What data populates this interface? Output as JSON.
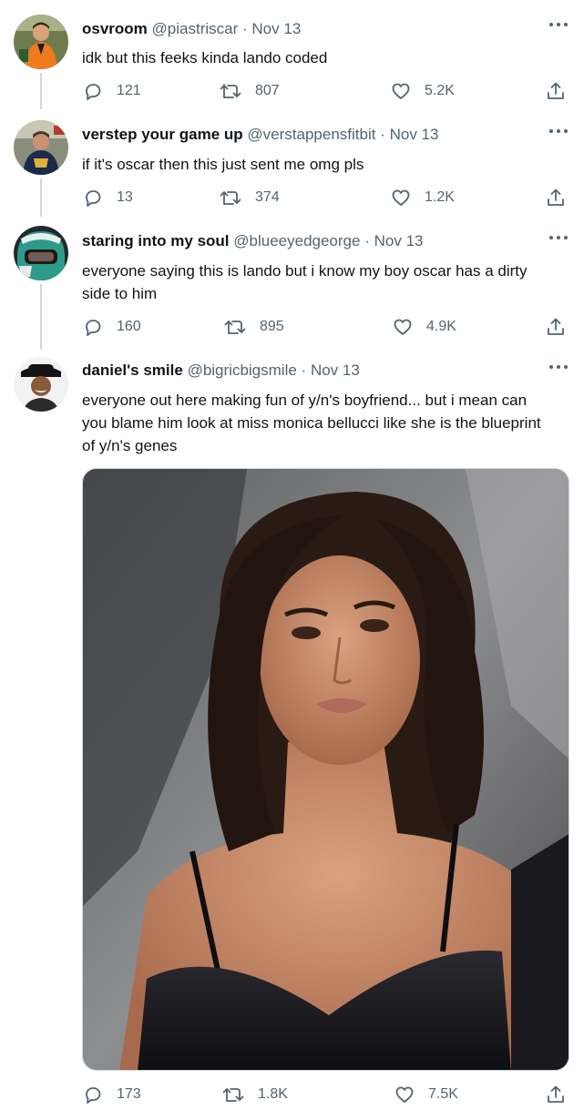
{
  "tweets": [
    {
      "display_name": "osvroom",
      "handle": "@piastriscar",
      "date": "Nov 13",
      "text": "idk but this feeks kinda lando coded",
      "replies": "121",
      "retweets": "807",
      "likes": "5.2K"
    },
    {
      "display_name": "verstep your game up",
      "handle": "@verstappensfitbit",
      "date": "Nov 13",
      "text": "if it's oscar then this just sent me omg pls",
      "replies": "13",
      "retweets": "374",
      "likes": "1.2K"
    },
    {
      "display_name": "staring into my soul",
      "handle": "@blueeyedgeorge",
      "date": "Nov 13",
      "text": "everyone saying this is lando but i know my boy oscar has a dirty side to him",
      "replies": "160",
      "retweets": "895",
      "likes": "4.9K"
    },
    {
      "display_name": "daniel's smile",
      "handle": "@bigricbigsmile",
      "date": "Nov 13",
      "text": "everyone out here making fun of y/n's boyfriend... but i mean can you blame him look at miss monica bellucci like she is the blueprint of y/n's genes",
      "replies": "173",
      "retweets": "1.8K",
      "likes": "7.5K"
    }
  ],
  "separator": "·",
  "icons": {
    "reply": "reply-icon",
    "retweet": "retweet-icon",
    "like": "heart-icon",
    "share": "share-icon",
    "more": "more-icon"
  },
  "colors": {
    "text": "#0f1419",
    "secondary": "#536471",
    "thread_line": "#cfd9de"
  }
}
